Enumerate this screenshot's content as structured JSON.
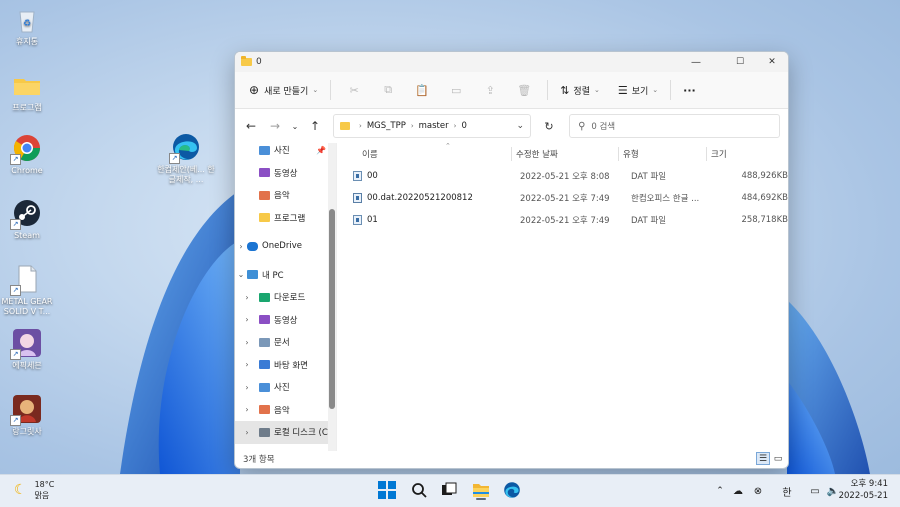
{
  "desktop": {
    "icons": [
      {
        "label": "휴지통"
      },
      {
        "label": "프로그램"
      },
      {
        "label": "Chrome"
      },
      {
        "label": "Steam"
      },
      {
        "label": "METAL GEAR SOLID V T..."
      },
      {
        "label": "에픽세븐"
      },
      {
        "label": "랑그릿사"
      },
      {
        "label": "한컴제안(베... 한글제작, ..."
      }
    ]
  },
  "window": {
    "title": "0",
    "controls": {
      "minimize": "—",
      "maximize": "☐",
      "close": "✕"
    },
    "commandbar": {
      "new_label": "새로 만들기",
      "sort_label": "정렬",
      "view_label": "보기",
      "more_label": "···"
    },
    "address": {
      "crumbs": [
        "MGS_TPP",
        "master",
        "0"
      ]
    },
    "search": {
      "placeholder": "0 검색"
    },
    "nav": {
      "items": [
        {
          "label": "사진",
          "pinned": true
        },
        {
          "label": "동영상"
        },
        {
          "label": "음악"
        },
        {
          "label": "프로그램"
        },
        {
          "label": "OneDrive"
        },
        {
          "label": "내 PC"
        },
        {
          "label": "다운로드"
        },
        {
          "label": "동영상"
        },
        {
          "label": "문서"
        },
        {
          "label": "바탕 화면"
        },
        {
          "label": "사진"
        },
        {
          "label": "음악"
        },
        {
          "label": "로컬 디스크 (C:"
        }
      ]
    },
    "columns": {
      "name": "이름",
      "date": "수정한 날짜",
      "type": "유형",
      "size": "크기"
    },
    "files": [
      {
        "name": "00",
        "date": "2022-05-21 오후 8:08",
        "type": "DAT 파일",
        "size": "488,926KB"
      },
      {
        "name": "00.dat.20220521200812",
        "date": "2022-05-21 오후 7:49",
        "type": "한컴오피스 한글 ...",
        "size": "484,692KB"
      },
      {
        "name": "01",
        "date": "2022-05-21 오후 7:49",
        "type": "DAT 파일",
        "size": "258,718KB"
      }
    ],
    "status": {
      "count": "3개 항목"
    }
  },
  "taskbar": {
    "weather": {
      "temp": "18°C",
      "condition": "맑음"
    },
    "tray": {
      "ime": "한"
    },
    "clock": {
      "time": "오후 9:41",
      "date": "2022-05-21"
    }
  },
  "colors": {
    "accent": "#0067c0",
    "folder": "#f7c948"
  }
}
